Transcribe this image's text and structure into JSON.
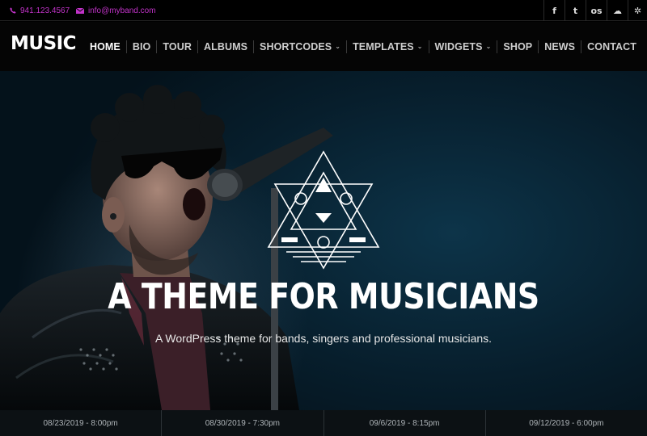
{
  "topbar": {
    "phone": "941.123.4567",
    "email": "info@myband.com",
    "social": [
      {
        "icon": "facebook-icon",
        "glyph": "f"
      },
      {
        "icon": "twitter-icon",
        "glyph": "t"
      },
      {
        "icon": "lastfm-icon",
        "glyph": "os"
      },
      {
        "icon": "soundcloud-icon",
        "glyph": "☁"
      },
      {
        "icon": "yelp-icon",
        "glyph": "✲"
      }
    ]
  },
  "header": {
    "logo": "MUSIC",
    "nav": [
      {
        "label": "HOME",
        "active": true,
        "dropdown": false
      },
      {
        "label": "BIO",
        "active": false,
        "dropdown": false
      },
      {
        "label": "TOUR",
        "active": false,
        "dropdown": false
      },
      {
        "label": "ALBUMS",
        "active": false,
        "dropdown": false
      },
      {
        "label": "SHORTCODES",
        "active": false,
        "dropdown": true
      },
      {
        "label": "TEMPLATES",
        "active": false,
        "dropdown": true
      },
      {
        "label": "WIDGETS",
        "active": false,
        "dropdown": true
      },
      {
        "label": "SHOP",
        "active": false,
        "dropdown": false
      },
      {
        "label": "NEWS",
        "active": false,
        "dropdown": false
      },
      {
        "label": "CONTACT",
        "active": false,
        "dropdown": false
      }
    ]
  },
  "hero": {
    "title": "A THEME FOR MUSICIANS",
    "subtitle": "A WordPress theme for bands, singers and professional musicians."
  },
  "events": [
    "08/23/2019 - 8:00pm",
    "08/30/2019 - 7:30pm",
    "09/6/2019 - 8:15pm",
    "09/12/2019 - 6:00pm"
  ],
  "colors": {
    "accent": "#c233c9",
    "background": "#000000",
    "hero": "#0a2a3c"
  }
}
